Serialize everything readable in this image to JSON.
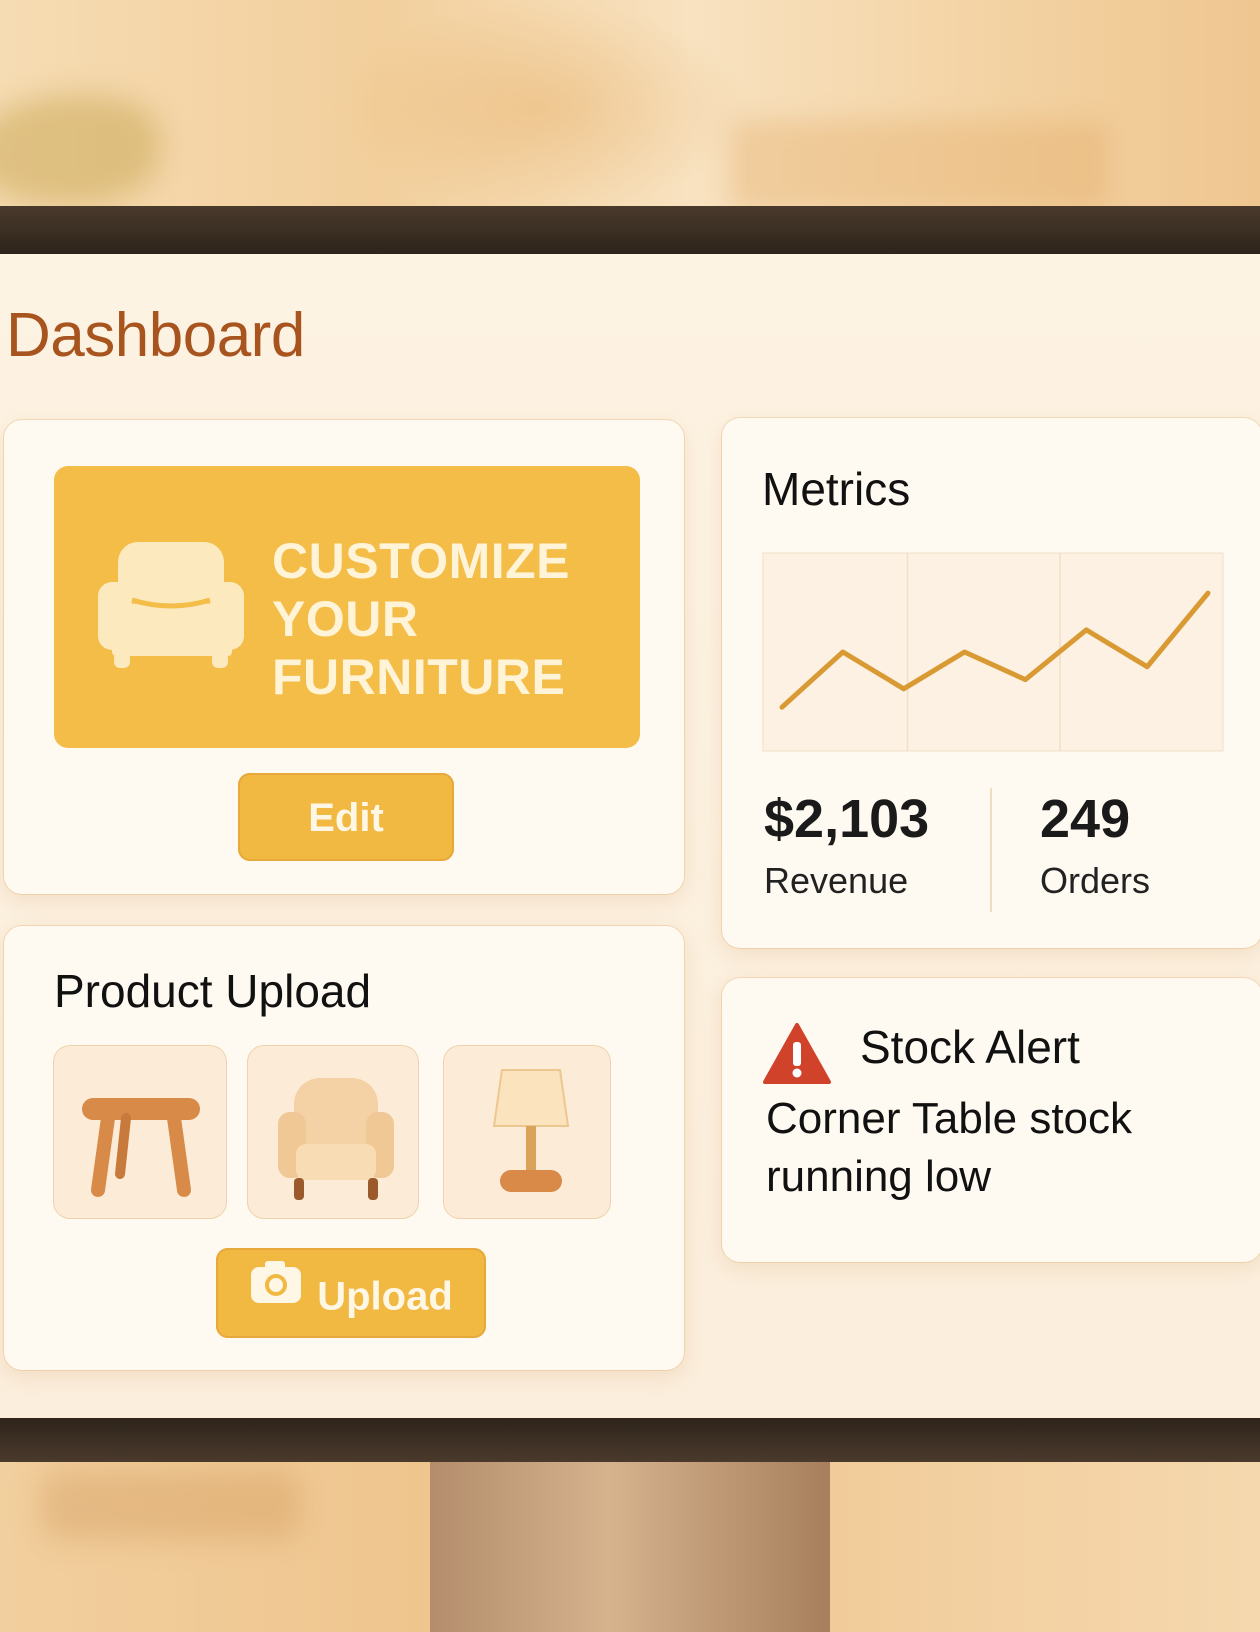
{
  "header": {
    "title": "Dashboard"
  },
  "customize_card": {
    "banner_lines": [
      "CUSTOMIZE",
      "YOUR",
      "FURNITURE"
    ],
    "banner_icon": "armchair-icon",
    "edit_label": "Edit"
  },
  "upload_card": {
    "title": "Product Upload",
    "products": [
      {
        "icon": "stool-icon"
      },
      {
        "icon": "armchair-icon"
      },
      {
        "icon": "lamp-icon"
      }
    ],
    "upload_icon": "camera-icon",
    "upload_label": "Upload"
  },
  "metrics_card": {
    "title": "Metrics",
    "revenue": {
      "value": "$2,103",
      "label": "Revenue"
    },
    "orders": {
      "value": "249",
      "label": "Orders"
    }
  },
  "chart_data": {
    "type": "line",
    "title": "",
    "xlabel": "",
    "ylabel": "",
    "x": [
      1,
      2,
      3,
      4,
      5,
      6,
      7,
      8
    ],
    "series": [
      {
        "values": [
          2,
          5,
          3,
          5,
          3.5,
          6.2,
          4.2,
          8.2
        ]
      }
    ],
    "ylim": [
      0,
      10
    ],
    "grid": true
  },
  "alert_card": {
    "icon": "warning-icon",
    "title": "Stock Alert",
    "message": "Corner Table stock running low"
  },
  "colors": {
    "accent": "#f3bd47",
    "title": "#a8541f",
    "alert": "#d0432a",
    "chart_line": "#d99a34"
  }
}
